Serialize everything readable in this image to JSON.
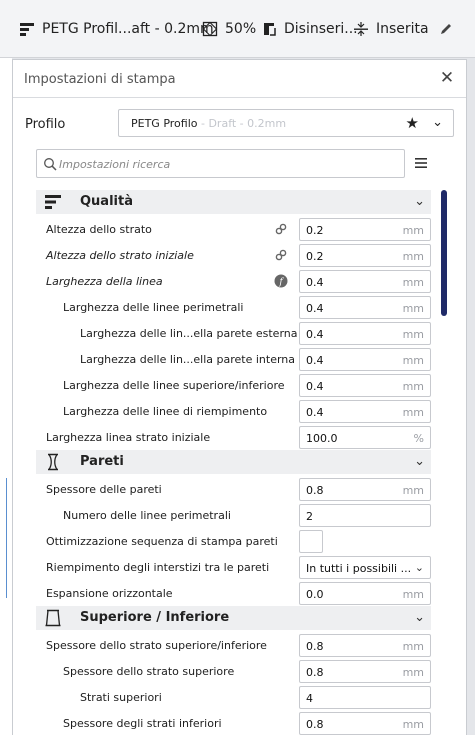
{
  "topbar": {
    "profile": "PETG Profil...aft - 0.2mm",
    "infill": "50%",
    "support": "Disinseri...",
    "adhesion": "Inserita"
  },
  "panel": {
    "title": "Impostazioni di stampa",
    "profile_label": "Profilo",
    "profile_name": "PETG Profilo",
    "profile_sub": " - Draft - 0.2mm",
    "search_placeholder": "Impostazioni ricerca"
  },
  "sections": {
    "quality": "Qualità",
    "walls": "Pareti",
    "topbottom": "Superiore / Inferiore"
  },
  "rows": {
    "r1": {
      "label": "Altezza dello strato",
      "value": "0.2",
      "unit": "mm"
    },
    "r2": {
      "label": "Altezza dello strato iniziale",
      "value": "0.2",
      "unit": "mm"
    },
    "r3": {
      "label": "Larghezza della linea",
      "value": "0.4",
      "unit": "mm"
    },
    "r4": {
      "label": "Larghezza delle linee perimetrali",
      "value": "0.4",
      "unit": "mm"
    },
    "r5": {
      "label": "Larghezza delle lin...ella parete esterna",
      "value": "0.4",
      "unit": "mm"
    },
    "r6": {
      "label": "Larghezza delle lin...ella parete interna",
      "value": "0.4",
      "unit": "mm"
    },
    "r7": {
      "label": "Larghezza delle linee superiore/inferiore",
      "value": "0.4",
      "unit": "mm"
    },
    "r8": {
      "label": "Larghezza delle linee di riempimento",
      "value": "0.4",
      "unit": "mm"
    },
    "r9": {
      "label": "Larghezza linea strato iniziale",
      "value": "100.0",
      "unit": "%"
    },
    "w1": {
      "label": "Spessore delle pareti",
      "value": "0.8",
      "unit": "mm"
    },
    "w2": {
      "label": "Numero delle linee perimetrali",
      "value": "2",
      "unit": ""
    },
    "w3": {
      "label": "Ottimizzazione sequenza di stampa pareti"
    },
    "w4": {
      "label": "Riempimento degli interstizi tra le pareti",
      "value": "In tutti i possibili ..."
    },
    "w5": {
      "label": "Espansione orizzontale",
      "value": "0.0",
      "unit": "mm"
    },
    "t1": {
      "label": "Spessore dello strato superiore/inferiore",
      "value": "0.8",
      "unit": "mm"
    },
    "t2": {
      "label": "Spessore dello strato superiore",
      "value": "0.8",
      "unit": "mm"
    },
    "t3": {
      "label": "Strati superiori",
      "value": "4",
      "unit": ""
    },
    "t4": {
      "label": "Spessore degli strati inferiori",
      "value": "0.8",
      "unit": "mm"
    }
  }
}
